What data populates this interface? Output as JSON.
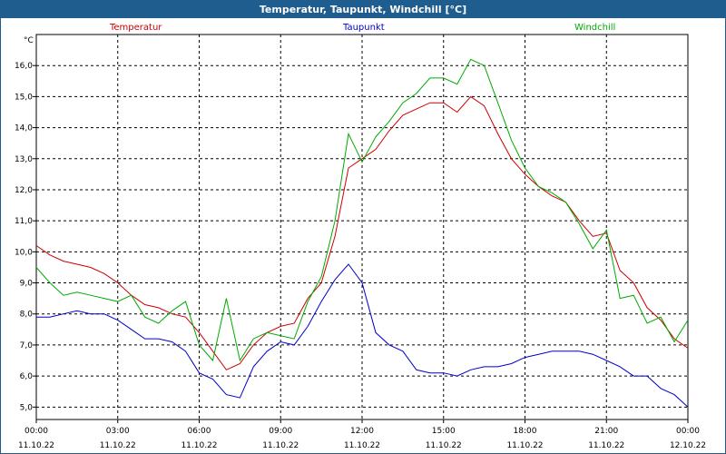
{
  "title": "Temperatur, Taupunkt, Windchill [°C]",
  "colors": {
    "titlebar": "#1f5d8f",
    "temperatur": "#cc0000",
    "taupunkt": "#0000cc",
    "windchill": "#00aa00"
  },
  "chart_data": {
    "type": "line",
    "title": "Temperatur, Taupunkt, Windchill [°C]",
    "ylabel": "°C",
    "ylim": [
      4.6,
      17.0
    ],
    "y_ticks": [
      "5,0",
      "6,0",
      "7,0",
      "8,0",
      "9,0",
      "10,0",
      "11,0",
      "12,0",
      "13,0",
      "14,0",
      "15,0",
      "16,0"
    ],
    "y_tick_values": [
      5,
      6,
      7,
      8,
      9,
      10,
      11,
      12,
      13,
      14,
      15,
      16
    ],
    "xlim": [
      0,
      24
    ],
    "x_ticks": [
      {
        "t": 0,
        "time": "00:00",
        "date": "11.10.22"
      },
      {
        "t": 3,
        "time": "03:00",
        "date": "11.10.22"
      },
      {
        "t": 6,
        "time": "06:00",
        "date": "11.10.22"
      },
      {
        "t": 9,
        "time": "09:00",
        "date": "11.10.22"
      },
      {
        "t": 12,
        "time": "12:00",
        "date": "11.10.22"
      },
      {
        "t": 15,
        "time": "15:00",
        "date": "11.10.22"
      },
      {
        "t": 18,
        "time": "18:00",
        "date": "11.10.22"
      },
      {
        "t": 21,
        "time": "21:00",
        "date": "11.10.22"
      },
      {
        "t": 24,
        "time": "00:00",
        "date": "12.10.22"
      }
    ],
    "grid": true,
    "legend_placement": "top",
    "series": [
      {
        "name": "Temperatur",
        "color": "#cc0000",
        "x": [
          0,
          0.5,
          1,
          1.5,
          2,
          2.5,
          3,
          3.5,
          4,
          4.5,
          5,
          5.5,
          6,
          6.5,
          7,
          7.5,
          8,
          8.5,
          9,
          9.5,
          10,
          10.5,
          11,
          11.5,
          12,
          12.5,
          13,
          13.5,
          14,
          14.5,
          15,
          15.5,
          16,
          16.5,
          17,
          17.5,
          18,
          18.5,
          19,
          19.5,
          20,
          20.5,
          21,
          21.5,
          22,
          22.5,
          23,
          23.5,
          24
        ],
        "y": [
          10.2,
          9.9,
          9.7,
          9.6,
          9.5,
          9.3,
          9.0,
          8.6,
          8.3,
          8.2,
          8.0,
          7.9,
          7.4,
          6.8,
          6.2,
          6.4,
          7.0,
          7.4,
          7.6,
          7.7,
          8.5,
          9.0,
          10.5,
          12.7,
          13.0,
          13.3,
          13.9,
          14.4,
          14.6,
          14.8,
          14.8,
          14.5,
          15.0,
          14.7,
          13.8,
          13.0,
          12.5,
          12.1,
          11.8,
          11.6,
          11.0,
          10.5,
          10.6,
          9.4,
          9.0,
          8.2,
          7.8,
          7.2,
          6.9
        ]
      },
      {
        "name": "Taupunkt",
        "color": "#0000cc",
        "x": [
          0,
          0.5,
          1,
          1.5,
          2,
          2.5,
          3,
          3.5,
          4,
          4.5,
          5,
          5.5,
          6,
          6.5,
          7,
          7.5,
          8,
          8.5,
          9,
          9.5,
          10,
          10.5,
          11,
          11.5,
          12,
          12.5,
          13,
          13.5,
          14,
          14.5,
          15,
          15.5,
          16,
          16.5,
          17,
          17.5,
          18,
          18.5,
          19,
          19.5,
          20,
          20.5,
          21,
          21.5,
          22,
          22.5,
          23,
          23.5,
          24
        ],
        "y": [
          7.9,
          7.9,
          8.0,
          8.1,
          8.0,
          8.0,
          7.8,
          7.5,
          7.2,
          7.2,
          7.1,
          6.8,
          6.1,
          5.9,
          5.4,
          5.3,
          6.3,
          6.8,
          7.1,
          7.0,
          7.6,
          8.4,
          9.1,
          9.6,
          9.0,
          7.4,
          7.0,
          6.8,
          6.2,
          6.1,
          6.1,
          6.0,
          6.2,
          6.3,
          6.3,
          6.4,
          6.6,
          6.7,
          6.8,
          6.8,
          6.8,
          6.7,
          6.5,
          6.3,
          6.0,
          6.0,
          5.6,
          5.4,
          5.0
        ]
      },
      {
        "name": "Windchill",
        "color": "#00aa00",
        "x": [
          0,
          0.5,
          1,
          1.5,
          2,
          2.5,
          3,
          3.5,
          4,
          4.5,
          5,
          5.5,
          6,
          6.5,
          7,
          7.5,
          8,
          8.5,
          9,
          9.5,
          10,
          10.5,
          11,
          11.5,
          12,
          12.5,
          13,
          13.5,
          14,
          14.5,
          15,
          15.5,
          16,
          16.5,
          17,
          17.5,
          18,
          18.5,
          19,
          19.5,
          20,
          20.5,
          21,
          21.5,
          22,
          22.5,
          23,
          23.5,
          24
        ],
        "y": [
          9.5,
          9.0,
          8.6,
          8.7,
          8.6,
          8.5,
          8.4,
          8.6,
          7.9,
          7.7,
          8.1,
          8.4,
          7.0,
          6.5,
          8.5,
          6.5,
          7.2,
          7.4,
          7.3,
          7.2,
          8.4,
          9.2,
          11.0,
          13.8,
          12.9,
          13.7,
          14.2,
          14.8,
          15.1,
          15.6,
          15.6,
          15.4,
          16.2,
          16.0,
          14.8,
          13.6,
          12.7,
          12.1,
          11.9,
          11.6,
          10.9,
          10.1,
          10.7,
          8.5,
          8.6,
          7.7,
          7.9,
          7.1,
          7.8
        ]
      }
    ]
  }
}
